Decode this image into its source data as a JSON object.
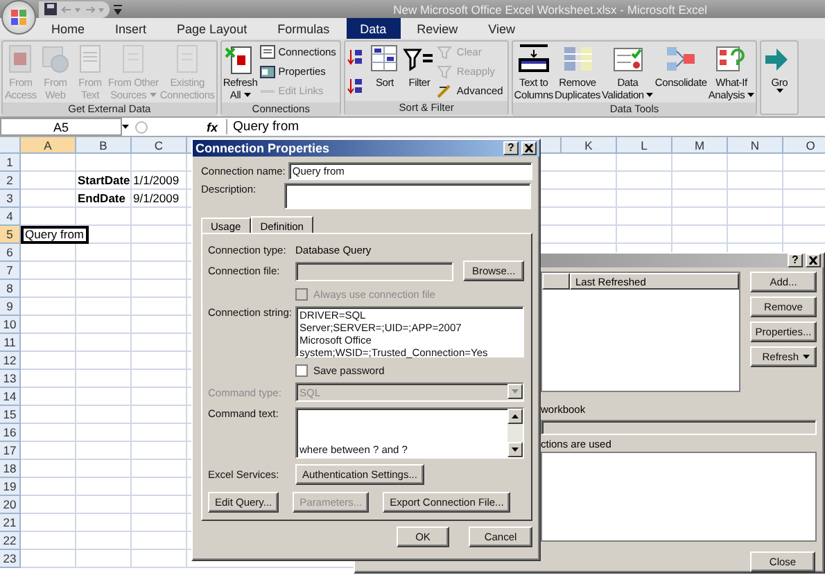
{
  "window": {
    "title": "New Microsoft Office Excel Worksheet.xlsx - Microsoft Excel"
  },
  "tabs": [
    {
      "label": "Home",
      "selected": false
    },
    {
      "label": "Insert",
      "selected": false
    },
    {
      "label": "Page Layout",
      "selected": false
    },
    {
      "label": "Formulas",
      "selected": false
    },
    {
      "label": "Data",
      "selected": true
    },
    {
      "label": "Review",
      "selected": false
    },
    {
      "label": "View",
      "selected": false
    }
  ],
  "ribbon": [
    {
      "label": "Get External Data",
      "items": [
        {
          "kind": "large",
          "lines": [
            "From",
            "Access"
          ],
          "disabled": true
        },
        {
          "kind": "large",
          "lines": [
            "From",
            "Web"
          ],
          "disabled": true
        },
        {
          "kind": "large",
          "lines": [
            "From",
            "Text"
          ],
          "disabled": true
        },
        {
          "kind": "large",
          "lines": [
            "From Other",
            "Sources"
          ],
          "disabled": true,
          "dropdown": true
        },
        {
          "kind": "large",
          "lines": [
            "Existing",
            "Connections"
          ],
          "disabled": true
        }
      ]
    },
    {
      "label": "Connections",
      "items": [
        {
          "kind": "large",
          "lines": [
            "Refresh",
            "All"
          ],
          "disabled": false,
          "dropdown": true
        },
        {
          "kind": "small",
          "lines": [
            "Connections"
          ],
          "disabled": false
        },
        {
          "kind": "small",
          "lines": [
            "Properties"
          ],
          "disabled": false
        },
        {
          "kind": "small",
          "lines": [
            "Edit Links"
          ],
          "disabled": true
        }
      ]
    },
    {
      "label": "Sort & Filter",
      "items": [
        {
          "kind": "icon",
          "disabled": false
        },
        {
          "kind": "icon",
          "disabled": false
        },
        {
          "kind": "large",
          "lines": [
            "Sort"
          ],
          "disabled": false
        },
        {
          "kind": "large",
          "lines": [
            "Filter"
          ],
          "disabled": false
        },
        {
          "kind": "small",
          "lines": [
            "Clear"
          ],
          "disabled": true
        },
        {
          "kind": "small",
          "lines": [
            "Reapply"
          ],
          "disabled": true
        },
        {
          "kind": "small",
          "lines": [
            "Advanced"
          ],
          "disabled": false
        }
      ]
    },
    {
      "label": "Data Tools",
      "items": [
        {
          "kind": "large",
          "lines": [
            "Text to",
            "Columns"
          ],
          "disabled": false
        },
        {
          "kind": "large",
          "lines": [
            "Remove",
            "Duplicates"
          ],
          "disabled": false
        },
        {
          "kind": "large",
          "lines": [
            "Data",
            "Validation"
          ],
          "disabled": false,
          "dropdown": true
        },
        {
          "kind": "large",
          "lines": [
            "Consolidate"
          ],
          "disabled": false
        },
        {
          "kind": "large",
          "lines": [
            "What-If",
            "Analysis"
          ],
          "disabled": false,
          "dropdown": true
        }
      ]
    },
    {
      "items": [
        {
          "kind": "large",
          "lines": [
            "Gro"
          ],
          "disabled": false,
          "dropdown": true
        }
      ]
    }
  ],
  "formula_bar": {
    "name_box": "A5",
    "fx": "fx",
    "content": "Query from"
  },
  "sheet": {
    "columns_left": [
      {
        "label": "A",
        "selected": true
      },
      {
        "label": "B",
        "selected": false
      },
      {
        "label": "C",
        "selected": false
      }
    ],
    "columns_right": [
      {
        "label": "K",
        "selected": false
      },
      {
        "label": "L",
        "selected": false
      },
      {
        "label": "M",
        "selected": false
      },
      {
        "label": "N",
        "selected": false
      },
      {
        "label": "O",
        "selected": false
      }
    ],
    "rows": [
      {
        "label": "1",
        "selected": false
      },
      {
        "label": "2",
        "selected": false,
        "cells": [
          {},
          {
            "text": "StartDate",
            "bold": true
          },
          {
            "text": "1/1/2009",
            "bold": false
          }
        ]
      },
      {
        "label": "3",
        "selected": false,
        "cells": [
          {},
          {
            "text": "EndDate",
            "bold": true
          },
          {
            "text": "9/1/2009",
            "bold": false
          }
        ]
      },
      {
        "label": "4",
        "selected": false
      },
      {
        "label": "5",
        "selected": true,
        "cells": [
          {
            "text": "Query from",
            "bold": false,
            "selected": true
          }
        ]
      },
      {
        "label": "6",
        "selected": false
      },
      {
        "label": "7",
        "selected": false
      },
      {
        "label": "8",
        "selected": false
      },
      {
        "label": "9",
        "selected": false
      },
      {
        "label": "10",
        "selected": false
      },
      {
        "label": "11",
        "selected": false
      },
      {
        "label": "12",
        "selected": false
      },
      {
        "label": "13",
        "selected": false
      },
      {
        "label": "14",
        "selected": false
      },
      {
        "label": "15",
        "selected": false
      },
      {
        "label": "16",
        "selected": false
      },
      {
        "label": "17",
        "selected": false
      },
      {
        "label": "18",
        "selected": false
      },
      {
        "label": "19",
        "selected": false
      },
      {
        "label": "20",
        "selected": false
      },
      {
        "label": "21",
        "selected": false
      },
      {
        "label": "22",
        "selected": false
      },
      {
        "label": "23",
        "selected": false
      }
    ]
  },
  "workbook_connections": {
    "help": "?",
    "column_header": "Last Refreshed",
    "buttons": [
      {
        "label": "Add..."
      },
      {
        "label": "Remove"
      },
      {
        "label": "Properties..."
      },
      {
        "label": "Refresh",
        "dropdown": true
      }
    ],
    "section_label": "workbook",
    "usage_label": "ctions are used",
    "close": "Close"
  },
  "connection_properties": {
    "title": "Connection Properties",
    "help": "?",
    "name_label": "Connection name:",
    "name_value": "Query from",
    "description_label": "Description:",
    "tabs": [
      {
        "label": "Usage",
        "selected": false
      },
      {
        "label": "Definition",
        "selected": true
      }
    ],
    "type_label": "Connection type:",
    "type_value": "Database Query",
    "file_label": "Connection file:",
    "browse": "Browse...",
    "always_use": {
      "label": "Always use connection file",
      "checked": false,
      "disabled": true
    },
    "string_label": "Connection string:",
    "string_lines": [
      "DRIVER=SQL",
      "Server;SERVER=;UID=;APP=2007",
      "Microsoft Office",
      "system;WSID=;Trusted_Connection=Yes"
    ],
    "save_password": {
      "label": "Save password",
      "checked": false,
      "disabled": false
    },
    "command_type_label": "Command type:",
    "command_type": "SQL",
    "command_type_disabled": true,
    "command_text_label": "Command text:",
    "command_text": "where between ? and ?",
    "services_label": "Excel Services:",
    "auth_button": "Authentication Settings...",
    "action_buttons": [
      {
        "label": "Edit Query...",
        "disabled": false
      },
      {
        "label": "Parameters...",
        "disabled": true
      },
      {
        "label": "Export Connection File...",
        "disabled": false
      }
    ],
    "ok": "OK",
    "cancel": "Cancel"
  }
}
